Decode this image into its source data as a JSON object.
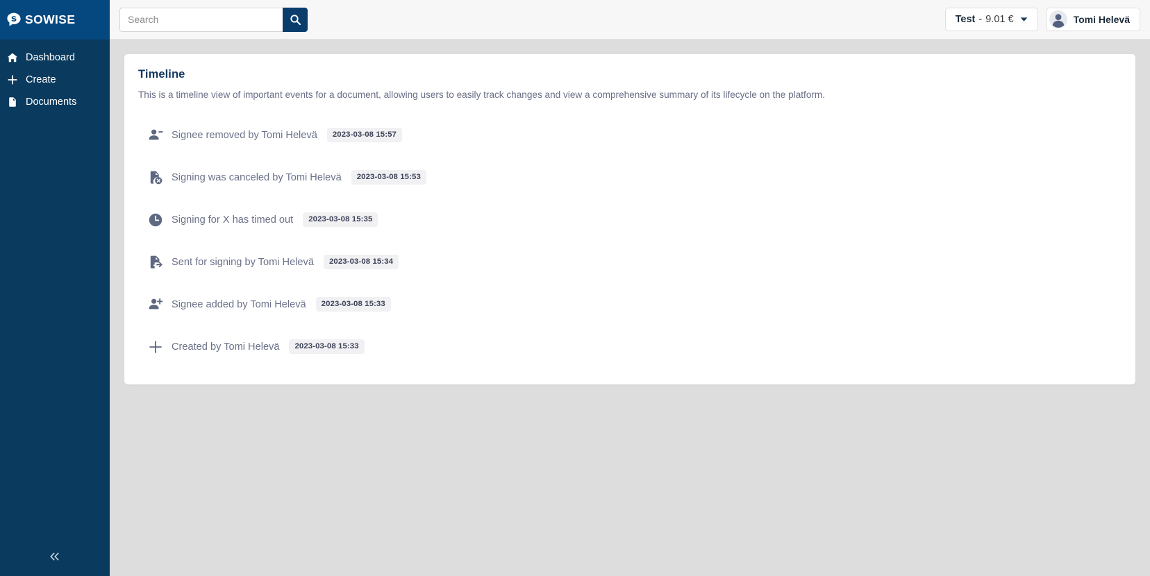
{
  "brand": {
    "logo_text": "SOWISE",
    "logo_icon": "speech-bubble-s-icon",
    "sidebar_header_color": "#05487f",
    "sidebar_color": "#0a3a5e",
    "accent_color": "#0a3d6b",
    "page_background": "#dddddd"
  },
  "sidebar": {
    "items": [
      {
        "label": "Dashboard",
        "icon": "home-icon"
      },
      {
        "label": "Create",
        "icon": "plus-icon"
      },
      {
        "label": "Documents",
        "icon": "document-icon"
      }
    ],
    "collapse_icon": "chevron-double-left-icon"
  },
  "topbar": {
    "search": {
      "placeholder": "Search",
      "value": "",
      "button_icon": "search-icon"
    },
    "org_switcher": {
      "name": "Test",
      "separator": "-",
      "balance": "9.01 €",
      "caret_icon": "chevron-down-icon"
    },
    "user_menu": {
      "name": "Tomi Helevä",
      "avatar_icon": "user-avatar-icon"
    }
  },
  "main": {
    "title": "Timeline",
    "description": "This is a timeline view of important events for a document, allowing users to easily track changes and view a comprehensive summary of its lifecycle on the platform.",
    "events": [
      {
        "icon": "person-minus-icon",
        "label": "Signee removed by Tomi Helevä",
        "time": "2023-03-08 15:57"
      },
      {
        "icon": "document-cancel-icon",
        "label": "Signing was canceled by Tomi Helevä",
        "time": "2023-03-08 15:53"
      },
      {
        "icon": "clock-icon",
        "label": "Signing for X has timed out",
        "time": "2023-03-08 15:35"
      },
      {
        "icon": "document-send-icon",
        "label": "Sent for signing by Tomi Helevä",
        "time": "2023-03-08 15:34"
      },
      {
        "icon": "person-plus-icon",
        "label": "Signee added by Tomi Helevä",
        "time": "2023-03-08 15:33"
      },
      {
        "icon": "plus-icon",
        "label": "Created by Tomi Helevä",
        "time": "2023-03-08 15:33"
      }
    ]
  }
}
